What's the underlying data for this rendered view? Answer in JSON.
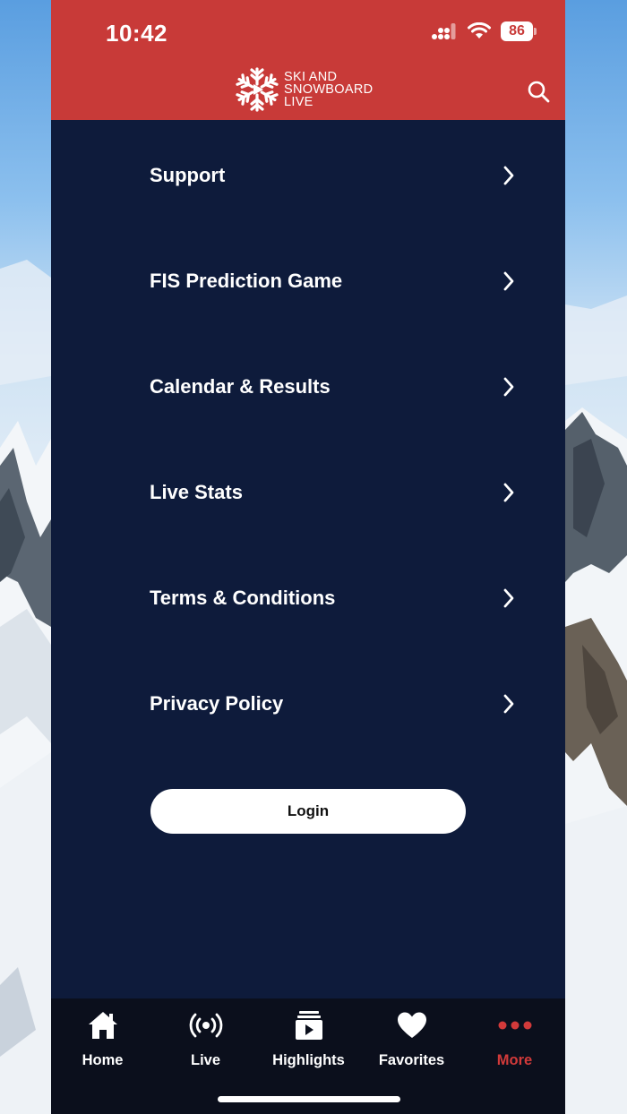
{
  "status_bar": {
    "time": "10:42",
    "battery": "86"
  },
  "header": {
    "logo_line1": "SKI AND",
    "logo_line2": "SNOWBOARD",
    "logo_line3": "LIVE"
  },
  "menu": {
    "items": [
      {
        "label": "Support",
        "icon": "chevron-right-icon"
      },
      {
        "label": "FIS Prediction Game",
        "icon": "chevron-right-icon"
      },
      {
        "label": "Calendar & Results",
        "icon": "chevron-right-icon"
      },
      {
        "label": "Live Stats",
        "icon": "chevron-right-icon"
      },
      {
        "label": "Terms & Conditions",
        "icon": "chevron-right-icon"
      },
      {
        "label": "Privacy Policy",
        "icon": "chevron-right-icon"
      }
    ],
    "login_label": "Login"
  },
  "tabbar": {
    "tabs": [
      {
        "label": "Home",
        "icon": "home-icon"
      },
      {
        "label": "Live",
        "icon": "broadcast-icon"
      },
      {
        "label": "Highlights",
        "icon": "video-stack-icon"
      },
      {
        "label": "Favorites",
        "icon": "heart-icon"
      },
      {
        "label": "More",
        "icon": "more-dots-icon"
      }
    ],
    "active_tab": "More"
  },
  "colors": {
    "header_red": "#c83a38",
    "background_navy": "#0e1b3b",
    "tabbar": "#0b0f1c",
    "active_tab": "#d23a3a"
  }
}
